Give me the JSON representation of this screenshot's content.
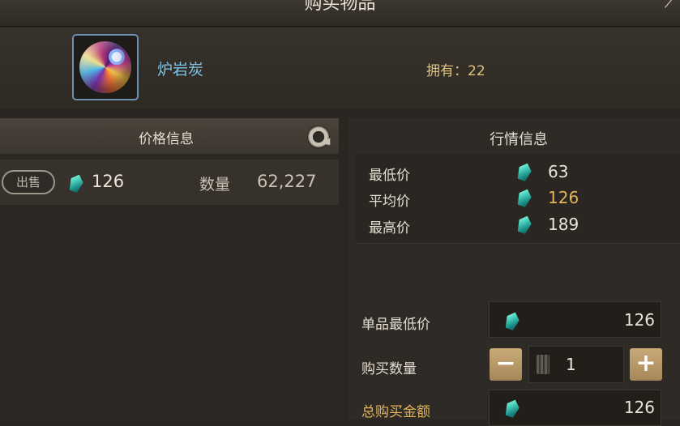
{
  "window": {
    "title": "购买物品"
  },
  "item": {
    "name": "炉岩炭",
    "owned_label": "拥有：",
    "owned_count": "22"
  },
  "price_panel": {
    "title": "价格信息",
    "listing": {
      "type_label": "出售",
      "price": "126",
      "quantity_label": "数量",
      "quantity": "62,227"
    }
  },
  "market_panel": {
    "title": "行情信息",
    "rows": [
      {
        "label": "最低价",
        "value": "63"
      },
      {
        "label": "平均价",
        "value": "126"
      },
      {
        "label": "最高价",
        "value": "189"
      }
    ]
  },
  "purchase": {
    "unit_min_label": "单品最低价",
    "unit_min_value": "126",
    "quantity_label": "购买数量",
    "quantity_value": "1",
    "minus": "−",
    "plus": "+",
    "total_label": "总购买金额",
    "total_value": "126"
  },
  "colors": {
    "accent_gold": "#e4b55a",
    "item_name_blue": "#7fc3e6",
    "gem": "#4fd6c0"
  },
  "icons": [
    "close-icon",
    "refresh-icon",
    "gem-currency-icon",
    "calculator-icon"
  ]
}
